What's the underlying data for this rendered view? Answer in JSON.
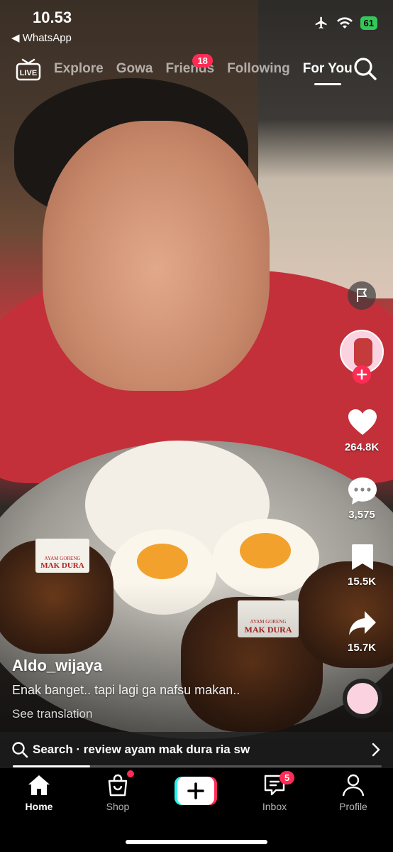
{
  "status_bar": {
    "time": "10.53",
    "back_app": "◀ WhatsApp",
    "battery": "61"
  },
  "top_nav": {
    "live_label": "LIVE",
    "tabs": [
      {
        "label": "Explore"
      },
      {
        "label": "Gowa"
      },
      {
        "label": "Friends",
        "badge": "18"
      },
      {
        "label": "Following"
      },
      {
        "label": "For You"
      }
    ],
    "active_tab": "For You"
  },
  "video": {
    "sticker_text_1": "AYAM GORENG",
    "sticker_text_2": "MAK DURA"
  },
  "right_rail": {
    "likes": "264.8K",
    "comments": "3,575",
    "saves": "15.5K",
    "shares": "15.7K"
  },
  "post": {
    "author": "Aldo_wijaya",
    "caption": "Enak banget.. tapi lagi ga nafsu makan..",
    "translate_link": "See translation"
  },
  "search_suggestion": {
    "text": "Search · review ayam mak dura ria sw",
    "progress": 0.21
  },
  "bottom_nav": {
    "home": "Home",
    "shop": "Shop",
    "inbox": "Inbox",
    "inbox_badge": "5",
    "profile": "Profile"
  },
  "colors": {
    "accent_red": "#fe2c55",
    "accent_cyan": "#25f4ee",
    "battery_green": "#34c759"
  }
}
